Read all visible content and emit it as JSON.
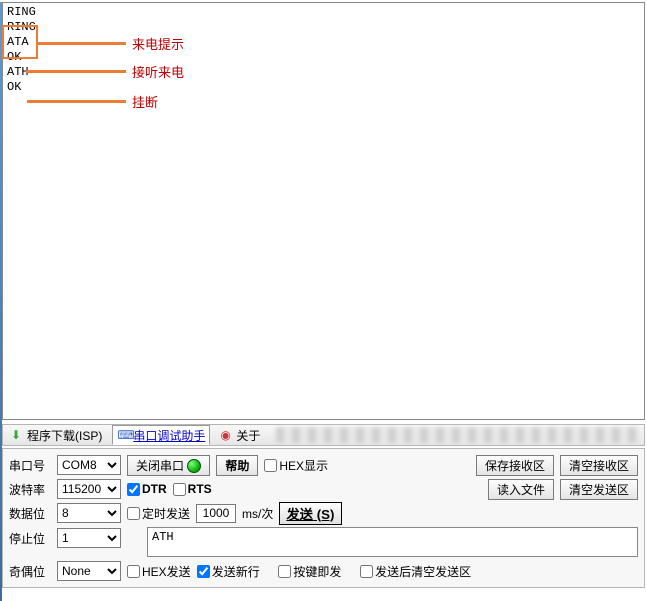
{
  "log": {
    "lines": [
      "",
      "RING",
      "",
      "RING",
      "ATA",
      "OK",
      "ATH",
      "OK"
    ]
  },
  "annotations": {
    "a1": "来电提示",
    "a2": "接听来电",
    "a3": "挂断"
  },
  "tabs": {
    "download": "程序下载(ISP)",
    "serial": "串口调试助手",
    "about": "关于"
  },
  "fields": {
    "port_label": "串口号",
    "port_value": "COM8",
    "baud_label": "波特率",
    "baud_value": "115200",
    "data_label": "数据位",
    "data_value": "8",
    "stop_label": "停止位",
    "stop_value": "1",
    "parity_label": "奇偶位",
    "parity_value": "None"
  },
  "buttons": {
    "close_port": "关闭串口",
    "help": "帮助",
    "save_recv": "保存接收区",
    "clear_recv": "清空接收区",
    "load_file": "读入文件",
    "clear_send": "清空发送区",
    "send": "发送 (S)"
  },
  "checks": {
    "dtr": "DTR",
    "rts": "RTS",
    "hex_disp": "HEX显示",
    "timed_send": "定时发送",
    "hex_send": "HEX发送",
    "send_newline": "发送新行",
    "key_send": "按键即发",
    "clear_after": "发送后清空发送区"
  },
  "timing": {
    "interval": "1000",
    "unit": "ms/次"
  },
  "send_text": "ATH"
}
